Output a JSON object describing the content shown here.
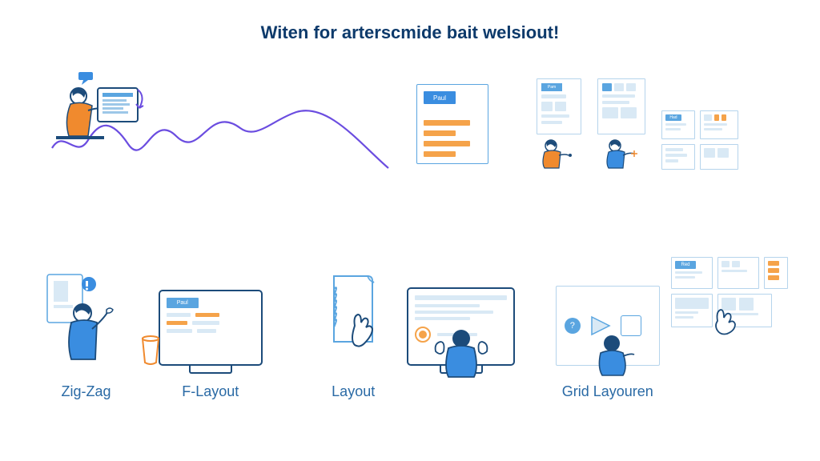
{
  "heading": "Witen for arterscmide bait welsiout!",
  "wireframe_badge": "Paul",
  "mini_badge": "Pam",
  "tile_badge_1": "Had",
  "tile_badge_2": "Red",
  "monitor_badge": "Paul",
  "grid_badge": "Red",
  "labels": {
    "zigzag": "Zig-Zag",
    "flayout": "F-Layout",
    "layout": "Layout",
    "grid": "Grid Layouren"
  },
  "colors": {
    "navy": "#0d3a6b",
    "blue": "#2a6aa5",
    "lightblue": "#5aa5e0",
    "paleblue": "#b5d4ec",
    "orange": "#f5a34a",
    "purple": "#6b4de0"
  }
}
